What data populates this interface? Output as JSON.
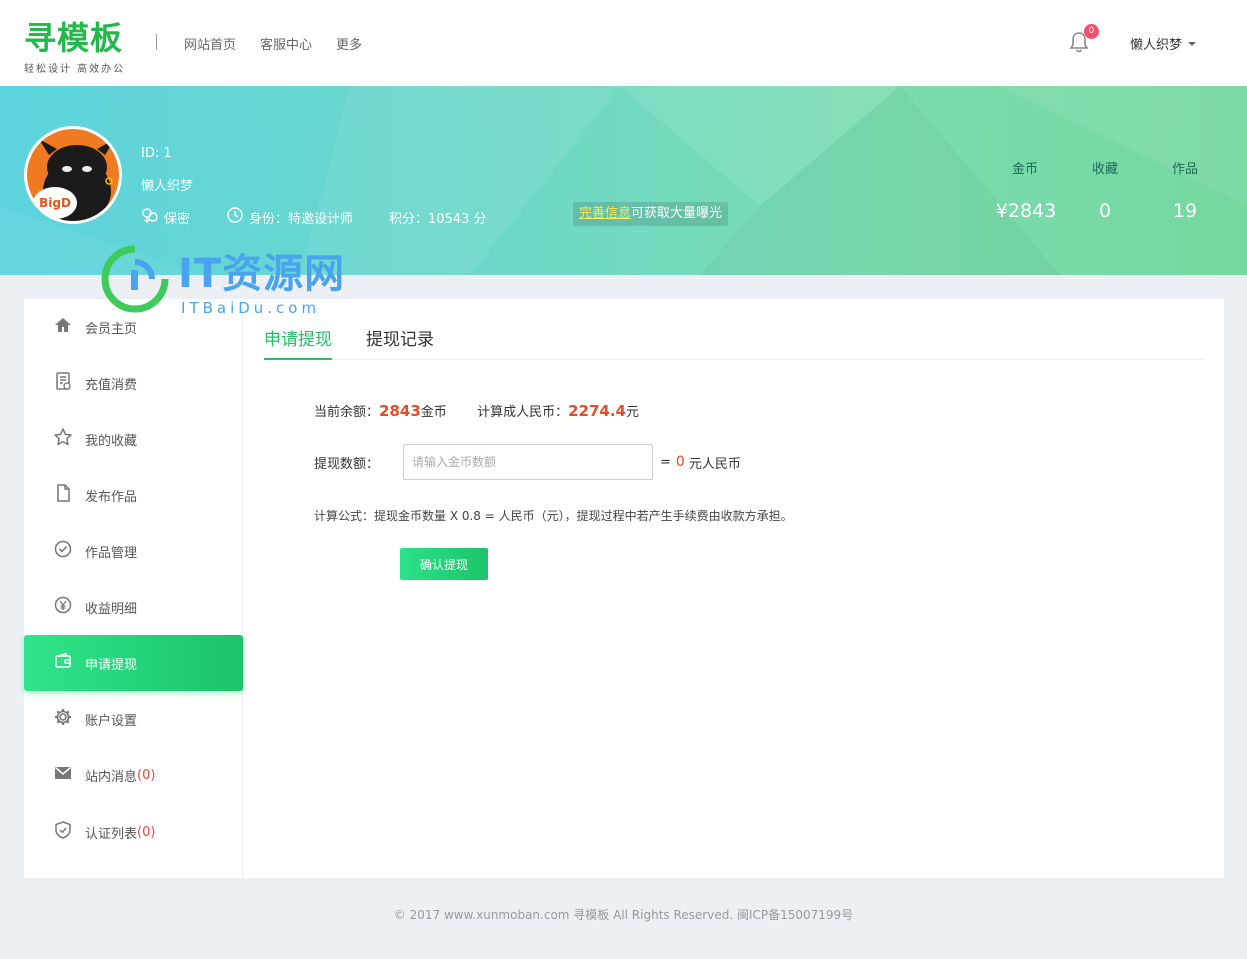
{
  "header": {
    "logo_text": "寻模板",
    "logo_tagline": "轻松设计 高效办公",
    "nav": [
      {
        "label": "网站首页"
      },
      {
        "label": "客服中心"
      },
      {
        "label": "更多"
      }
    ],
    "notification_count": "0",
    "user_name": "懒人织梦",
    "icons": {
      "bell": "bell-icon",
      "caret": "chevron-down-icon"
    }
  },
  "profile": {
    "avatar_text": "BigD",
    "id_label": "ID: 1",
    "name": "懒人织梦",
    "gender": "保密",
    "identity": "身份：特邀设计师",
    "points": "积分：10543 分",
    "complete_link": "完善信息",
    "complete_suffix": "可获取大量曝光",
    "stats": [
      {
        "label": "金币",
        "value": "¥2843"
      },
      {
        "label": "收藏",
        "value": "0"
      },
      {
        "label": "作品",
        "value": "19"
      }
    ]
  },
  "watermark": {
    "main": "IT资源网",
    "sub": "ITBaiDu.com"
  },
  "sidebar": {
    "items": [
      {
        "label": "会员主页",
        "icon": "home-icon"
      },
      {
        "label": "充值消费",
        "icon": "receipt-icon"
      },
      {
        "label": "我的收藏",
        "icon": "star-icon"
      },
      {
        "label": "发布作品",
        "icon": "document-icon"
      },
      {
        "label": "作品管理",
        "icon": "check-circle-icon"
      },
      {
        "label": "收益明细",
        "icon": "yen-icon"
      },
      {
        "label": "申请提现",
        "icon": "wallet-icon"
      },
      {
        "label": "账户设置",
        "icon": "gear-icon"
      },
      {
        "label": "站内消息",
        "icon": "mail-icon",
        "count": "(0)"
      },
      {
        "label": "认证列表",
        "icon": "shield-check-icon",
        "count": "(0)"
      }
    ]
  },
  "tabs": [
    {
      "label": "申请提现"
    },
    {
      "label": "提现记录"
    }
  ],
  "withdraw": {
    "balance_label": "当前余额：",
    "balance_value": "2843",
    "balance_unit": "金币",
    "rmb_label": "计算成人民币：",
    "rmb_value": "2274.4",
    "rmb_unit": "元",
    "amount_label": "提现数额：",
    "amount_placeholder": "请输入金币数额",
    "equals": "=",
    "result_value": "0",
    "result_unit": "元人民币",
    "formula": "计算公式：提现金币数量 X 0.8 = 人民币（元），提现过程中若产生手续费由收款方承担。",
    "submit_label": "确认提现"
  },
  "footer": {
    "text": "© 2017 www.xunmoban.com 寻模板 All Rights Reserved. 闽ICP备15007199号"
  },
  "colors": {
    "accent": "#22c065",
    "highlight": "#e84a2a",
    "banner_start": "#5cd3de",
    "banner_end": "#74d79e"
  }
}
